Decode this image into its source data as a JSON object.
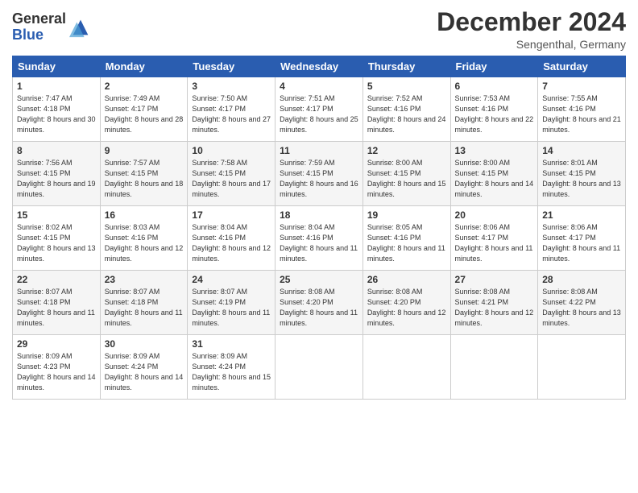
{
  "header": {
    "logo_line1": "General",
    "logo_line2": "Blue",
    "month_title": "December 2024",
    "location": "Sengenthal, Germany"
  },
  "weekdays": [
    "Sunday",
    "Monday",
    "Tuesday",
    "Wednesday",
    "Thursday",
    "Friday",
    "Saturday"
  ],
  "weeks": [
    [
      {
        "day": "1",
        "sunrise": "7:47 AM",
        "sunset": "4:18 PM",
        "daylight": "8 hours and 30 minutes."
      },
      {
        "day": "2",
        "sunrise": "7:49 AM",
        "sunset": "4:17 PM",
        "daylight": "8 hours and 28 minutes."
      },
      {
        "day": "3",
        "sunrise": "7:50 AM",
        "sunset": "4:17 PM",
        "daylight": "8 hours and 27 minutes."
      },
      {
        "day": "4",
        "sunrise": "7:51 AM",
        "sunset": "4:17 PM",
        "daylight": "8 hours and 25 minutes."
      },
      {
        "day": "5",
        "sunrise": "7:52 AM",
        "sunset": "4:16 PM",
        "daylight": "8 hours and 24 minutes."
      },
      {
        "day": "6",
        "sunrise": "7:53 AM",
        "sunset": "4:16 PM",
        "daylight": "8 hours and 22 minutes."
      },
      {
        "day": "7",
        "sunrise": "7:55 AM",
        "sunset": "4:16 PM",
        "daylight": "8 hours and 21 minutes."
      }
    ],
    [
      {
        "day": "8",
        "sunrise": "7:56 AM",
        "sunset": "4:15 PM",
        "daylight": "8 hours and 19 minutes."
      },
      {
        "day": "9",
        "sunrise": "7:57 AM",
        "sunset": "4:15 PM",
        "daylight": "8 hours and 18 minutes."
      },
      {
        "day": "10",
        "sunrise": "7:58 AM",
        "sunset": "4:15 PM",
        "daylight": "8 hours and 17 minutes."
      },
      {
        "day": "11",
        "sunrise": "7:59 AM",
        "sunset": "4:15 PM",
        "daylight": "8 hours and 16 minutes."
      },
      {
        "day": "12",
        "sunrise": "8:00 AM",
        "sunset": "4:15 PM",
        "daylight": "8 hours and 15 minutes."
      },
      {
        "day": "13",
        "sunrise": "8:00 AM",
        "sunset": "4:15 PM",
        "daylight": "8 hours and 14 minutes."
      },
      {
        "day": "14",
        "sunrise": "8:01 AM",
        "sunset": "4:15 PM",
        "daylight": "8 hours and 13 minutes."
      }
    ],
    [
      {
        "day": "15",
        "sunrise": "8:02 AM",
        "sunset": "4:15 PM",
        "daylight": "8 hours and 13 minutes."
      },
      {
        "day": "16",
        "sunrise": "8:03 AM",
        "sunset": "4:16 PM",
        "daylight": "8 hours and 12 minutes."
      },
      {
        "day": "17",
        "sunrise": "8:04 AM",
        "sunset": "4:16 PM",
        "daylight": "8 hours and 12 minutes."
      },
      {
        "day": "18",
        "sunrise": "8:04 AM",
        "sunset": "4:16 PM",
        "daylight": "8 hours and 11 minutes."
      },
      {
        "day": "19",
        "sunrise": "8:05 AM",
        "sunset": "4:16 PM",
        "daylight": "8 hours and 11 minutes."
      },
      {
        "day": "20",
        "sunrise": "8:06 AM",
        "sunset": "4:17 PM",
        "daylight": "8 hours and 11 minutes."
      },
      {
        "day": "21",
        "sunrise": "8:06 AM",
        "sunset": "4:17 PM",
        "daylight": "8 hours and 11 minutes."
      }
    ],
    [
      {
        "day": "22",
        "sunrise": "8:07 AM",
        "sunset": "4:18 PM",
        "daylight": "8 hours and 11 minutes."
      },
      {
        "day": "23",
        "sunrise": "8:07 AM",
        "sunset": "4:18 PM",
        "daylight": "8 hours and 11 minutes."
      },
      {
        "day": "24",
        "sunrise": "8:07 AM",
        "sunset": "4:19 PM",
        "daylight": "8 hours and 11 minutes."
      },
      {
        "day": "25",
        "sunrise": "8:08 AM",
        "sunset": "4:20 PM",
        "daylight": "8 hours and 11 minutes."
      },
      {
        "day": "26",
        "sunrise": "8:08 AM",
        "sunset": "4:20 PM",
        "daylight": "8 hours and 12 minutes."
      },
      {
        "day": "27",
        "sunrise": "8:08 AM",
        "sunset": "4:21 PM",
        "daylight": "8 hours and 12 minutes."
      },
      {
        "day": "28",
        "sunrise": "8:08 AM",
        "sunset": "4:22 PM",
        "daylight": "8 hours and 13 minutes."
      }
    ],
    [
      {
        "day": "29",
        "sunrise": "8:09 AM",
        "sunset": "4:23 PM",
        "daylight": "8 hours and 14 minutes."
      },
      {
        "day": "30",
        "sunrise": "8:09 AM",
        "sunset": "4:24 PM",
        "daylight": "8 hours and 14 minutes."
      },
      {
        "day": "31",
        "sunrise": "8:09 AM",
        "sunset": "4:24 PM",
        "daylight": "8 hours and 15 minutes."
      },
      null,
      null,
      null,
      null
    ]
  ],
  "labels": {
    "sunrise_label": "Sunrise:",
    "sunset_label": "Sunset:",
    "daylight_label": "Daylight:"
  }
}
